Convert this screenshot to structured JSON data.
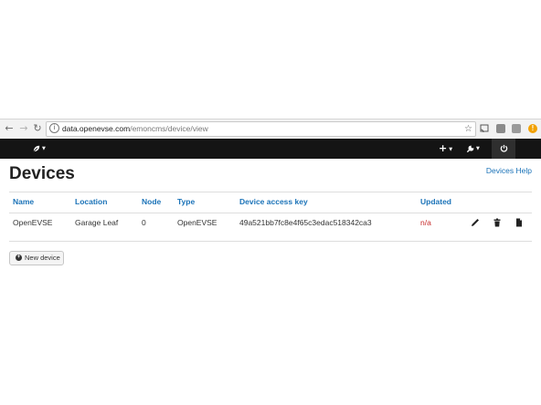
{
  "browser": {
    "url_host": "data.openevse.com",
    "url_path": "/emoncms/device/view"
  },
  "navbar": {
    "logo_icon": "leaf-icon",
    "add_icon": "plus-icon",
    "tools_icon": "wrench-icon",
    "power_icon": "power-icon"
  },
  "page": {
    "title": "Devices",
    "help_link": "Devices Help"
  },
  "table": {
    "headers": {
      "name": "Name",
      "location": "Location",
      "node": "Node",
      "type": "Type",
      "key": "Device access key",
      "updated": "Updated"
    },
    "rows": [
      {
        "name": "OpenEVSE",
        "location": "Garage Leaf",
        "node": "0",
        "type": "OpenEVSE",
        "key": "49a521bb7fc8e4f65c3edac518342ca3",
        "updated": "n/a"
      }
    ]
  },
  "new_device_button": "New device",
  "colors": {
    "link": "#1b73b8",
    "navbar": "#141414",
    "na_status": "#c62828"
  }
}
